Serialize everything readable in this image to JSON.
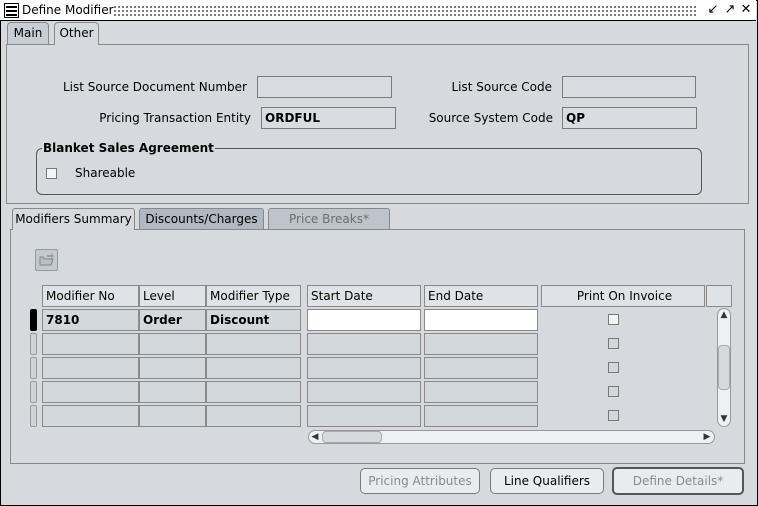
{
  "window": {
    "title": "Define Modifier",
    "title_buttons": [
      "minimize-icon",
      "maximize-icon",
      "close-icon"
    ]
  },
  "top_tabs": [
    {
      "label": "Main",
      "active": false
    },
    {
      "label": "Other",
      "active": true
    }
  ],
  "other": {
    "list_source_document_number": {
      "label": "List Source Document Number",
      "value": ""
    },
    "list_source_code": {
      "label": "List Source Code",
      "value": ""
    },
    "pricing_transaction_entity": {
      "label": "Pricing Transaction Entity",
      "value": "ORDFUL"
    },
    "source_system_code": {
      "label": "Source System Code",
      "value": "QP"
    },
    "blanket": {
      "title": "Blanket Sales Agreement",
      "shareable_label": "Shareable",
      "shareable_checked": false
    }
  },
  "sub_tabs": [
    {
      "label": "Modifiers Summary",
      "active": true
    },
    {
      "label": "Discounts/Charges",
      "active": false
    },
    {
      "label": "Price Breaks*",
      "disabled": true
    }
  ],
  "table": {
    "columns": [
      "Modifier No",
      "Level",
      "Modifier Type",
      "Start Date",
      "End Date",
      "Print On Invoice"
    ],
    "rows": [
      {
        "modifier_no": "7810",
        "level": "Order",
        "modifier_type": "Discount",
        "start_date": "",
        "end_date": "",
        "print_on_invoice": false
      },
      {
        "modifier_no": "",
        "level": "",
        "modifier_type": "",
        "start_date": "",
        "end_date": "",
        "print_on_invoice": false
      },
      {
        "modifier_no": "",
        "level": "",
        "modifier_type": "",
        "start_date": "",
        "end_date": "",
        "print_on_invoice": false
      },
      {
        "modifier_no": "",
        "level": "",
        "modifier_type": "",
        "start_date": "",
        "end_date": "",
        "print_on_invoice": false
      },
      {
        "modifier_no": "",
        "level": "",
        "modifier_type": "",
        "start_date": "",
        "end_date": "",
        "print_on_invoice": false
      }
    ]
  },
  "buttons": {
    "pricing_attributes": "Pricing Attributes",
    "line_qualifiers": "Line Qualifiers",
    "define_details": "Define Details*"
  }
}
